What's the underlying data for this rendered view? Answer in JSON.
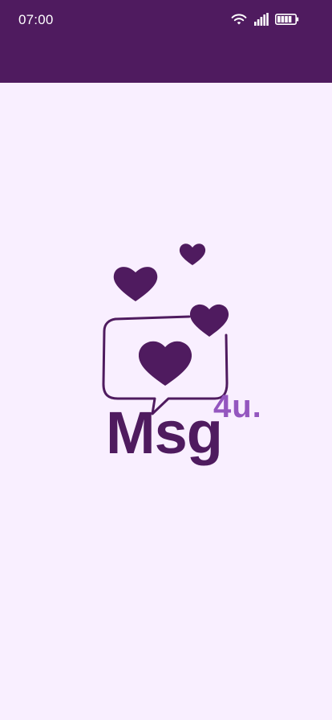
{
  "status_bar": {
    "time": "07:00",
    "icons": [
      "wifi-icon",
      "signal-icon",
      "battery-icon"
    ]
  },
  "colors": {
    "app_bar": "#4f1b5f",
    "background": "#f9efff",
    "logo_primary": "#4f1b5f",
    "logo_accent": "#9456bf"
  },
  "logo": {
    "word": "Msg",
    "suffix": "4u."
  }
}
